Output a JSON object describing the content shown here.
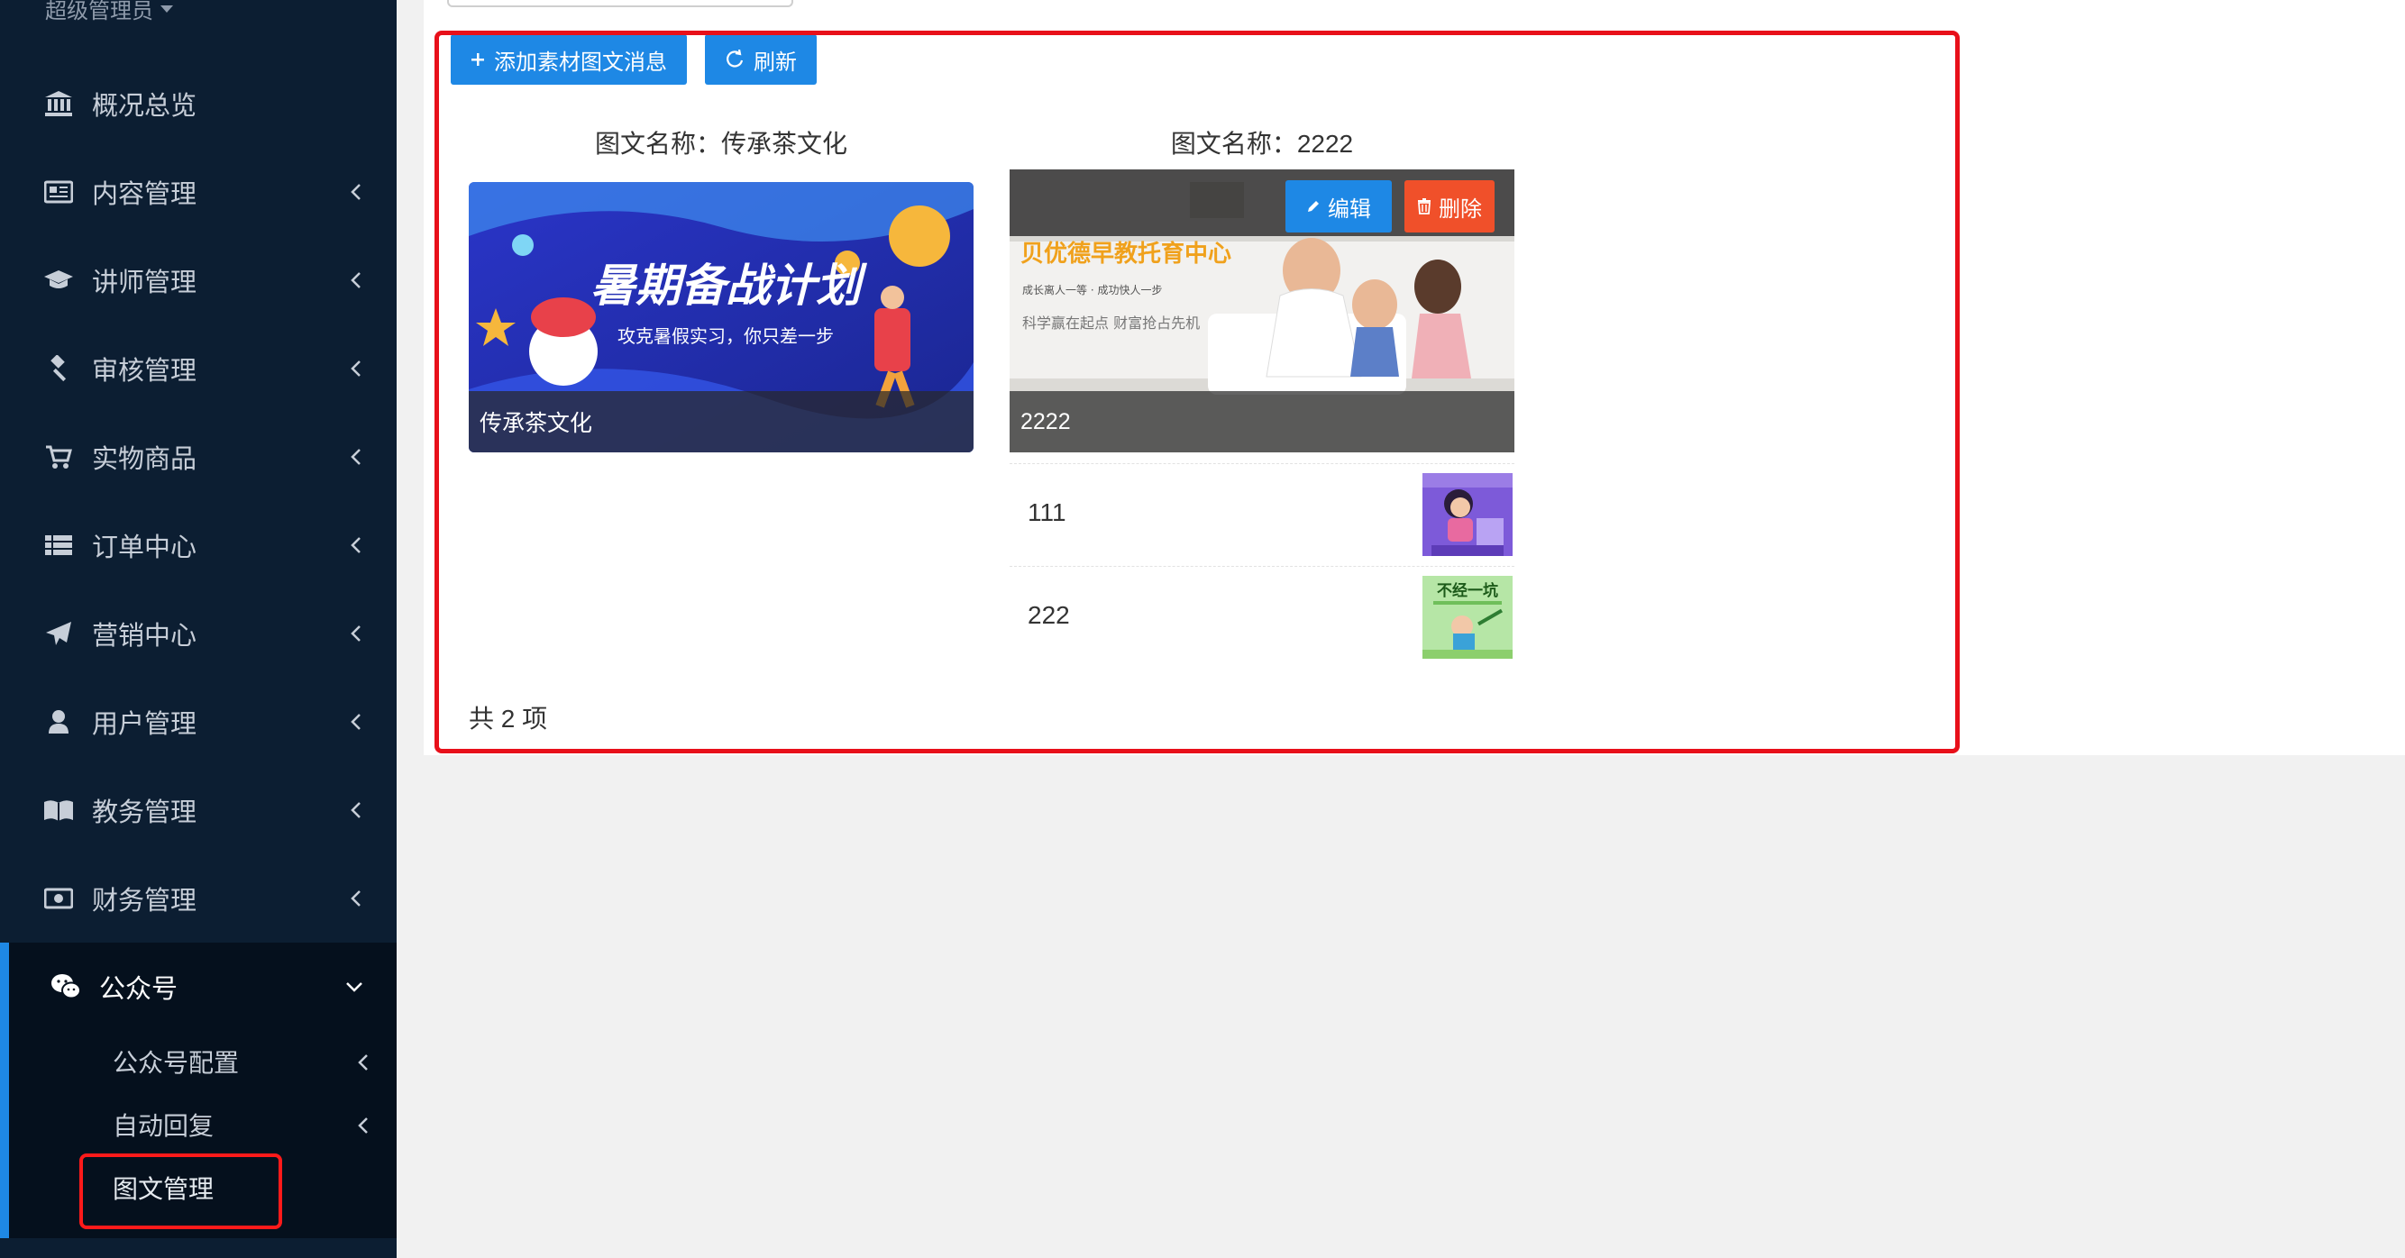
{
  "sidebar": {
    "user_role": "超级管理员",
    "items": [
      {
        "label": "概况总览",
        "icon": "bank-icon"
      },
      {
        "label": "内容管理",
        "icon": "newspaper-icon"
      },
      {
        "label": "讲师管理",
        "icon": "graduation-cap-icon"
      },
      {
        "label": "审核管理",
        "icon": "gavel-icon"
      },
      {
        "label": "实物商品",
        "icon": "cart-icon"
      },
      {
        "label": "订单中心",
        "icon": "list-icon"
      },
      {
        "label": "营销中心",
        "icon": "paper-plane-icon"
      },
      {
        "label": "用户管理",
        "icon": "user-icon"
      },
      {
        "label": "教务管理",
        "icon": "book-icon"
      },
      {
        "label": "财务管理",
        "icon": "money-icon"
      },
      {
        "label": "公众号",
        "icon": "wechat-icon"
      }
    ],
    "sub_items": [
      {
        "label": "公众号配置"
      },
      {
        "label": "自动回复"
      },
      {
        "label": "图文管理"
      }
    ]
  },
  "toolbar": {
    "add_label": "添加素材图文消息",
    "refresh_label": "刷新"
  },
  "cards": [
    {
      "title": "图文名称：传承茶文化",
      "cover_caption": "传承茶文化",
      "banner_heading": "暑期备战计划",
      "banner_sub": "攻克暑假实习，你只差一步"
    },
    {
      "title": "图文名称：2222",
      "cover_caption": "2222",
      "cover_heading": "贝优德早教托育中心",
      "cover_line1": "成长离人一等 · 成功快人一步",
      "cover_line2": "科学赢在起点 财富抢占先机",
      "edit_label": "编辑",
      "delete_label": "删除",
      "sub_articles": [
        {
          "title": "111"
        },
        {
          "title": "222",
          "thumb_text": "不经一坑"
        }
      ]
    }
  ],
  "footer": {
    "total": "共 2 项"
  },
  "colors": {
    "accent": "#1e88e5",
    "danger": "#f0502a",
    "highlight": "#e8101a",
    "sidebar": "#0c1e32"
  }
}
